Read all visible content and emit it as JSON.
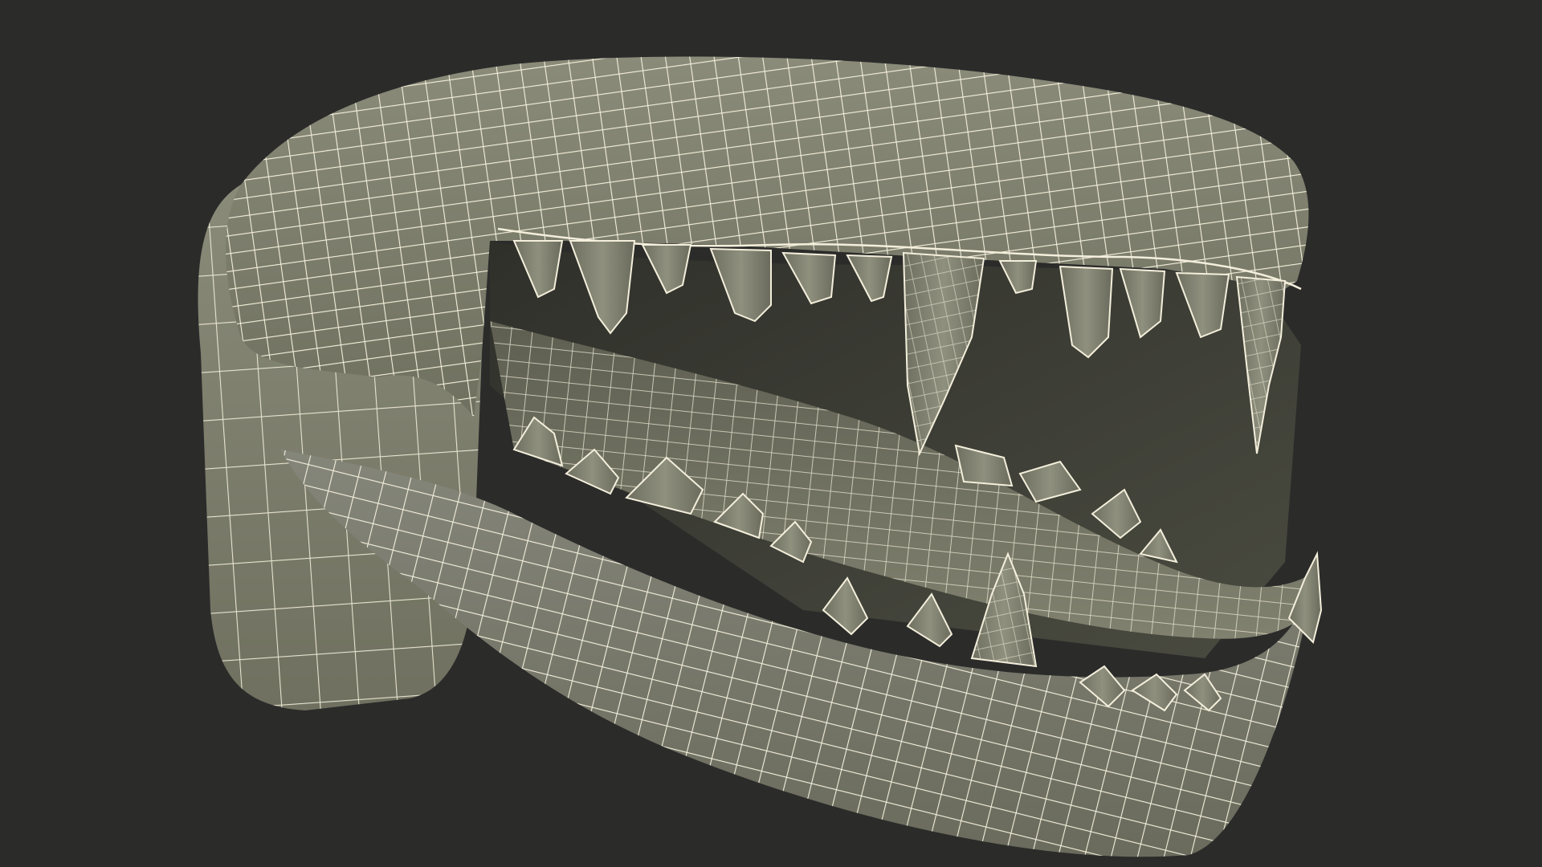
{
  "scene": {
    "subject": "wireframe-jaw-model",
    "colors": {
      "background": "#2b2b2a",
      "surface": "#7f806f",
      "surface_light": "#8c8d7b",
      "surface_dark": "#5a5b4d",
      "cavity": "#3a3b33",
      "wire": "#f4efdc"
    }
  }
}
